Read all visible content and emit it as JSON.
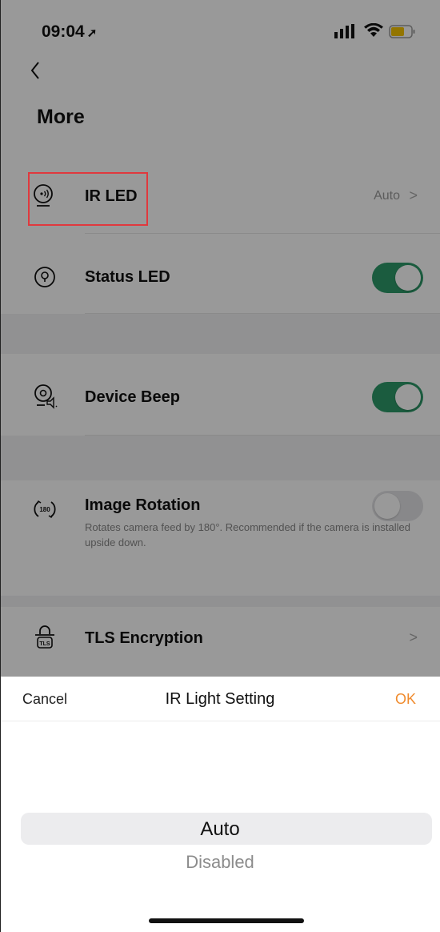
{
  "status_bar": {
    "time": "09:04",
    "location_glyph": "➚"
  },
  "page": {
    "title": "More"
  },
  "settings": [
    {
      "label": "IR LED",
      "value": "Auto",
      "icon": "ir-led-icon"
    },
    {
      "label": "Status LED",
      "toggle": "on",
      "icon": "status-led-icon"
    },
    {
      "label": "Device Beep",
      "toggle": "on",
      "icon": "device-beep-icon"
    },
    {
      "label": "Image Rotation",
      "description": "Rotates camera feed by 180°. Recommended if the camera is installed upside down.",
      "toggle": "off",
      "icon": "image-rotation-icon"
    },
    {
      "label": "TLS Encryption",
      "icon": "tls-icon"
    }
  ],
  "sheet": {
    "cancel": "Cancel",
    "title": "IR Light Setting",
    "ok": "OK",
    "options": [
      "Auto",
      "Disabled"
    ],
    "selected": "Auto"
  },
  "colors": {
    "accent": "#f08b2d",
    "toggle_on": "#2e9a6a",
    "highlight": "#e0393e"
  }
}
